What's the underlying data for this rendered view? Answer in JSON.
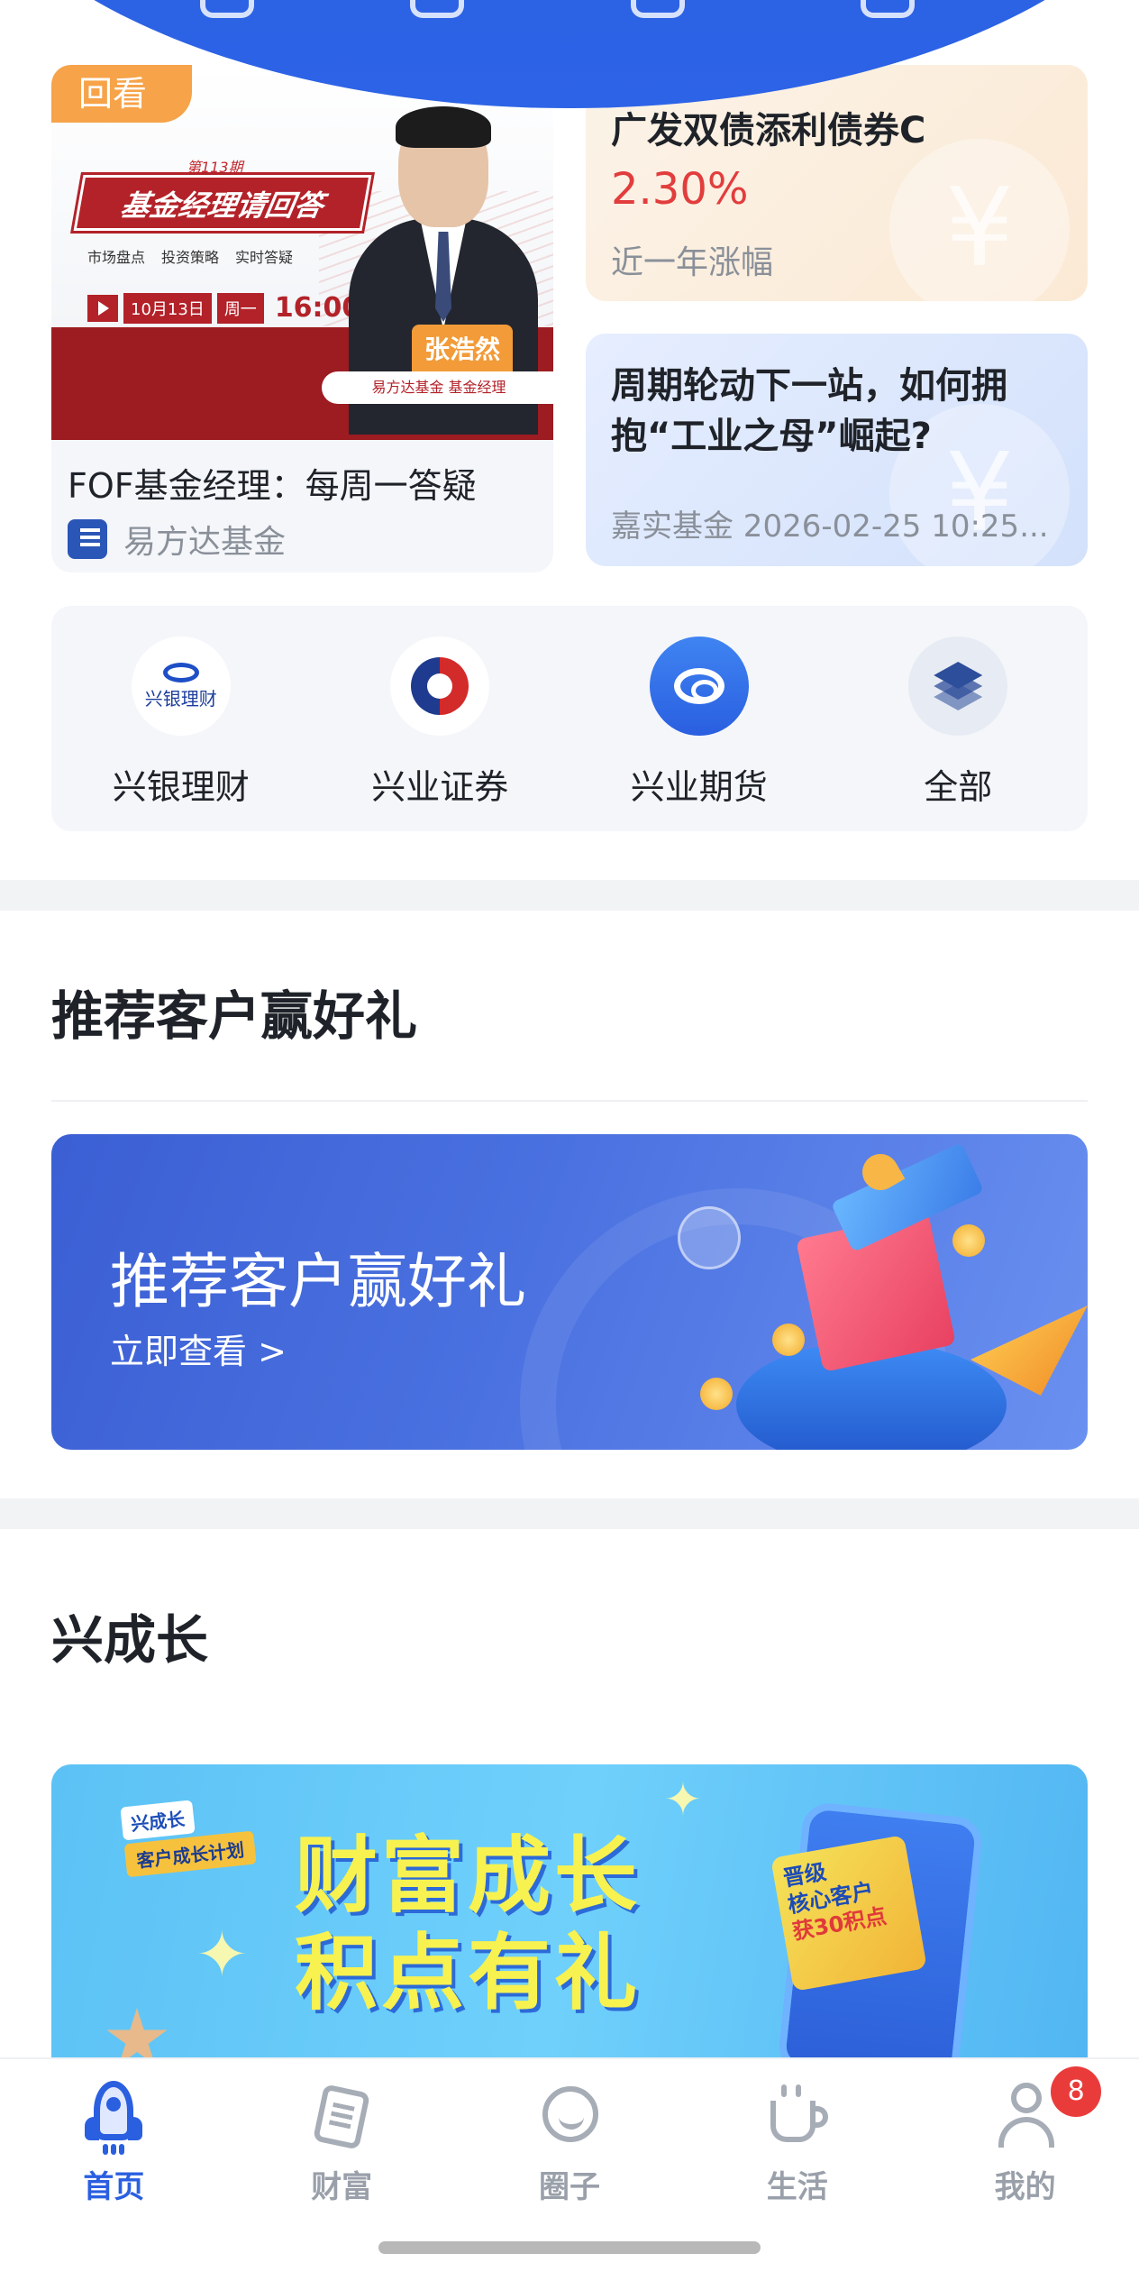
{
  "feature_cards": {
    "replay": {
      "badge": "回看",
      "poster": {
        "issue": "第113期",
        "title": "基金经理请回答",
        "tags": [
          "市场盘点",
          "投资策略",
          "实时答疑"
        ],
        "date": "10月13日",
        "weekday": "周一",
        "time": "16:00",
        "presenter_name": "张浩然",
        "footer": "易方达基金 基金经理"
      },
      "title": "FOF基金经理：每周一答疑",
      "source": "易方达基金"
    },
    "fund": {
      "name": "广发双债添利债券C",
      "return": "2.30%",
      "return_label": "近一年涨幅"
    },
    "article": {
      "title": "周期轮动下一站，如何拥抱“工业之母”崛起?",
      "meta": "嘉实基金 2026-02-25 10:25..."
    }
  },
  "partners": [
    {
      "label": "兴银理财",
      "logo_text": "兴银理财",
      "icon": "xingyin-logo-icon"
    },
    {
      "label": "兴业证券",
      "icon": "xingye-securities-logo-icon"
    },
    {
      "label": "兴业期货",
      "icon": "xingye-futures-logo-icon"
    },
    {
      "label": "全部",
      "icon": "layers-icon"
    }
  ],
  "referral": {
    "section_title": "推荐客户赢好礼",
    "banner_title": "推荐客户赢好礼",
    "banner_cta": "立即查看 >"
  },
  "growth": {
    "section_title": "兴成长",
    "badge_top": "兴成长",
    "badge_bottom": "客户成长计划",
    "title_line1": "财富成长",
    "title_line2": "积点有礼",
    "card_line1": "晋级",
    "card_line2": "核心客户",
    "card_line3": "获30积点"
  },
  "tabbar": {
    "tabs": [
      {
        "label": "首页",
        "icon": "rocket-icon",
        "active": true
      },
      {
        "label": "财富",
        "icon": "wallet-icon",
        "active": false
      },
      {
        "label": "圈子",
        "icon": "chat-icon",
        "active": false
      },
      {
        "label": "生活",
        "icon": "cup-icon",
        "active": false
      },
      {
        "label": "我的",
        "icon": "user-icon",
        "active": false
      }
    ],
    "badge_count": "8"
  },
  "colors": {
    "brand_blue": "#2a5fe0",
    "return_red": "#e23d3d",
    "badge_red": "#ea3b3b"
  }
}
